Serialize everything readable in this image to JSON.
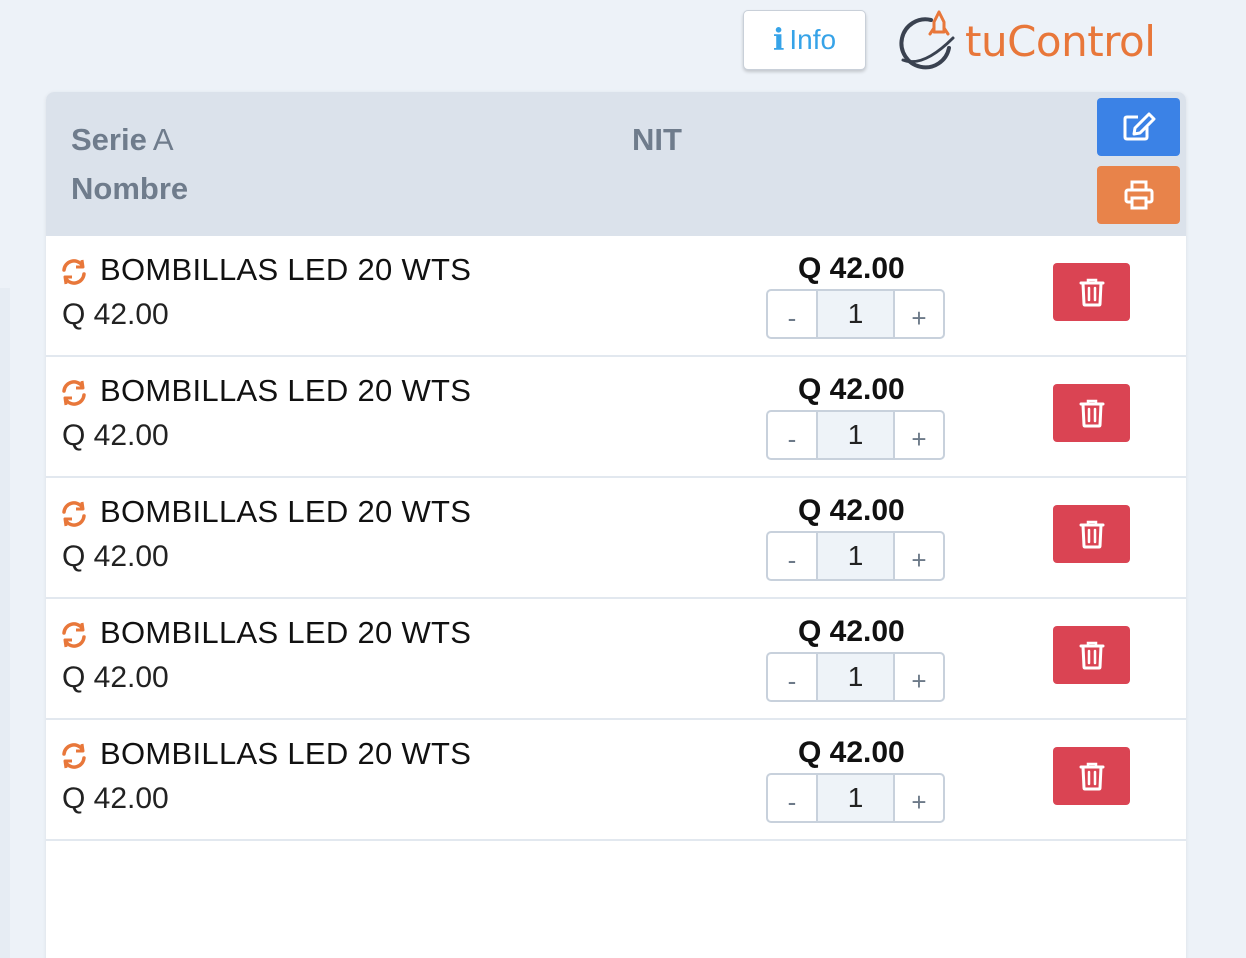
{
  "header": {
    "info_icon": "info-icon",
    "info_label": "Info",
    "logo_text": "tuControl",
    "logo_icon": "rocket-orbit-icon"
  },
  "invoice": {
    "serie_label": "Serie",
    "serie_value": "A",
    "nombre_label": "Nombre",
    "nit_label": "NIT",
    "edit_icon": "edit-icon",
    "print_icon": "print-icon"
  },
  "items": [
    {
      "name": "BOMBILLAS LED 20 WTS",
      "price": "Q 42.00",
      "total": "Q 42.00",
      "qty": "1",
      "minus": "-",
      "plus": "+"
    },
    {
      "name": "BOMBILLAS LED 20 WTS",
      "price": "Q 42.00",
      "total": "Q 42.00",
      "qty": "1",
      "minus": "-",
      "plus": "+"
    },
    {
      "name": "BOMBILLAS LED 20 WTS",
      "price": "Q 42.00",
      "total": "Q 42.00",
      "qty": "1",
      "minus": "-",
      "plus": "+"
    },
    {
      "name": "BOMBILLAS LED 20 WTS",
      "price": "Q 42.00",
      "total": "Q 42.00",
      "qty": "1",
      "minus": "-",
      "plus": "+"
    },
    {
      "name": "BOMBILLAS LED 20 WTS",
      "price": "Q 42.00",
      "total": "Q 42.00",
      "qty": "1",
      "minus": "-",
      "plus": "+"
    }
  ],
  "colors": {
    "background": "#edf2f8",
    "header_bg": "#dbe2eb",
    "accent_blue": "#3b82e6",
    "accent_orange": "#e8834a",
    "danger_red": "#da4453",
    "info_blue": "#36a3e8",
    "brand_orange": "#e8773a"
  }
}
